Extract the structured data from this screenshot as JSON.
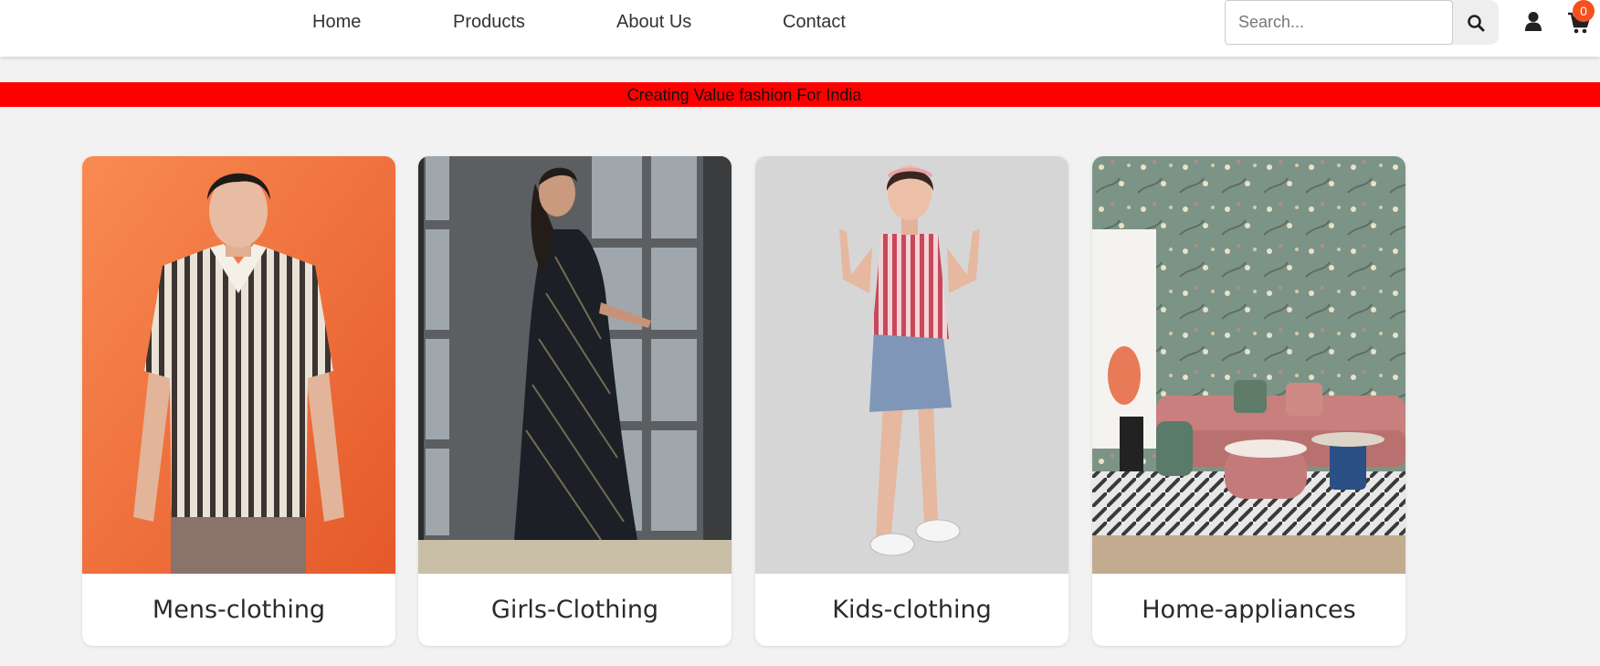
{
  "nav": {
    "links": [
      "Home",
      "Products",
      "About Us",
      "Contact"
    ]
  },
  "search": {
    "placeholder": "Search...",
    "value": "",
    "icon": "search-icon"
  },
  "header_icons": {
    "user_icon": "user-icon",
    "cart_icon": "cart-icon",
    "cart_count": "0",
    "badge_color": "#f4511e"
  },
  "banner": {
    "text": "Creating Value fashion For India",
    "color": "#ff0000"
  },
  "categories": [
    {
      "label": "Mens-clothing",
      "image": "man in striped shirt on orange background"
    },
    {
      "label": "Girls-Clothing",
      "image": "woman in dark saree by glass door"
    },
    {
      "label": "Kids-clothing",
      "image": "girl in striped top and denim skirt"
    },
    {
      "label": "Home-appliances",
      "image": "living room with pink sofa and floral wallpaper"
    }
  ]
}
